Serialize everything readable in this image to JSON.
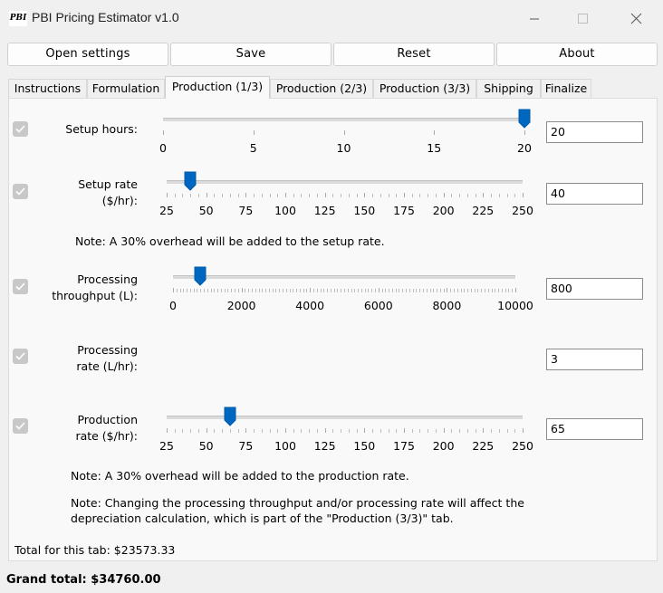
{
  "window": {
    "title": "PBI Pricing Estimator v1.0",
    "icon_text": "PBI"
  },
  "toolbar": {
    "open_settings": "Open settings",
    "save": "Save",
    "reset": "Reset",
    "about": "About"
  },
  "tabs": [
    {
      "label": "Instructions",
      "active": false
    },
    {
      "label": "Formulation",
      "active": false
    },
    {
      "label": "Production (1/3)",
      "active": true
    },
    {
      "label": "Production (2/3)",
      "active": false
    },
    {
      "label": "Production (3/3)",
      "active": false
    },
    {
      "label": "Shipping",
      "active": false
    },
    {
      "label": "Finalize",
      "active": false
    }
  ],
  "rows": {
    "setup_hours": {
      "label": "Setup hours:",
      "value": "20",
      "slider": {
        "min": 0,
        "max": 20,
        "value": 20,
        "ticks": [
          "0",
          "5",
          "10",
          "15",
          "20"
        ]
      }
    },
    "setup_rate": {
      "label_line1": "Setup rate",
      "label_line2": "($/hr):",
      "value": "40",
      "slider": {
        "min": 25,
        "max": 250,
        "value": 40,
        "ticks": [
          "25",
          "50",
          "75",
          "100",
          "125",
          "150",
          "175",
          "200",
          "225",
          "250"
        ]
      }
    },
    "processing_throughput": {
      "label_line1": "Processing",
      "label_line2": "throughput (L):",
      "value": "800",
      "slider": {
        "min": 0,
        "max": 10000,
        "value": 800,
        "ticks": [
          "0",
          "2000",
          "4000",
          "6000",
          "8000",
          "10000"
        ]
      }
    },
    "processing_rate": {
      "label_line1": "Processing",
      "label_line2": "rate (L/hr):",
      "value": "3"
    },
    "production_rate": {
      "label_line1": "Production",
      "label_line2": "rate ($/hr):",
      "value": "65",
      "slider": {
        "min": 25,
        "max": 250,
        "value": 65,
        "ticks": [
          "25",
          "50",
          "75",
          "100",
          "125",
          "150",
          "175",
          "200",
          "225",
          "250"
        ]
      }
    }
  },
  "notes": {
    "setup_overhead": "Note: A 30% overhead will be added to the setup rate.",
    "production_overhead": "Note: A 30% overhead will be added to the production rate.",
    "depreciation_line1": "Note: Changing the processing throughput and/or processing rate will affect the",
    "depreciation_line2": "depreciation calculation, which is part of the \"Production (3/3)\" tab."
  },
  "totals": {
    "tab_total": "Total for this tab: $23573.33",
    "grand_total": "Grand total: $34760.00"
  },
  "colors": {
    "accent": "#0067c0",
    "checkbox_disabled": "#c8c8c8",
    "panel_bg": "#f9f9f9",
    "window_bg": "#f0f0f0"
  }
}
